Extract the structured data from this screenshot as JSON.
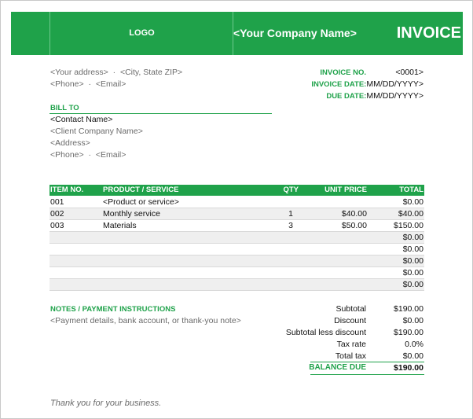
{
  "header": {
    "logo": "LOGO",
    "company": "<Your Company Name>",
    "title": "INVOICE"
  },
  "sender": {
    "address": "<Your address>",
    "city": "<City, State ZIP>",
    "phone": "<Phone>",
    "email": "<Email>",
    "sep": "·"
  },
  "meta": {
    "invoice_no_label": "INVOICE NO.",
    "invoice_no": "<0001>",
    "invoice_date_label": "INVOICE DATE:",
    "invoice_date": "MM/DD/YYYY>",
    "due_date_label": "DUE DATE:",
    "due_date": "MM/DD/YYYY>"
  },
  "bill_to": {
    "label": "BILL TO",
    "contact": "<Contact Name>",
    "company": "<Client Company Name>",
    "address": "<Address>",
    "phone": "<Phone>",
    "email": "<Email>"
  },
  "table": {
    "headers": {
      "item_no": "ITEM NO.",
      "product": "PRODUCT / SERVICE",
      "qty": "QTY",
      "unit_price": "UNIT PRICE",
      "total": "TOTAL"
    },
    "rows": [
      {
        "item": "001",
        "product": "<Product or service>",
        "qty": "",
        "price": "",
        "total": "$0.00"
      },
      {
        "item": "002",
        "product": "Monthly service",
        "qty": "1",
        "price": "$40.00",
        "total": "$40.00"
      },
      {
        "item": "003",
        "product": "Materials",
        "qty": "3",
        "price": "$50.00",
        "total": "$150.00"
      },
      {
        "item": "",
        "product": "",
        "qty": "",
        "price": "",
        "total": "$0.00"
      },
      {
        "item": "",
        "product": "",
        "qty": "",
        "price": "",
        "total": "$0.00"
      },
      {
        "item": "",
        "product": "",
        "qty": "",
        "price": "",
        "total": "$0.00"
      },
      {
        "item": "",
        "product": "",
        "qty": "",
        "price": "",
        "total": "$0.00"
      },
      {
        "item": "",
        "product": "",
        "qty": "",
        "price": "",
        "total": "$0.00"
      }
    ]
  },
  "notes": {
    "label": "NOTES / PAYMENT INSTRUCTIONS",
    "text": "<Payment details, bank account, or thank-you note>"
  },
  "totals": {
    "subtotal_label": "Subtotal",
    "subtotal": "$190.00",
    "discount_label": "Discount",
    "discount": "$0.00",
    "less_discount_label": "Subtotal less discount",
    "less_discount": "$190.00",
    "tax_rate_label": "Tax rate",
    "tax_rate": "0.0%",
    "total_tax_label": "Total tax",
    "total_tax": "$0.00",
    "balance_label": "BALANCE DUE",
    "balance": "$190.00"
  },
  "footer": {
    "thanks": "Thank you for your business."
  },
  "colors": {
    "accent": "#1fa24a",
    "row_alt": "#efefef"
  }
}
